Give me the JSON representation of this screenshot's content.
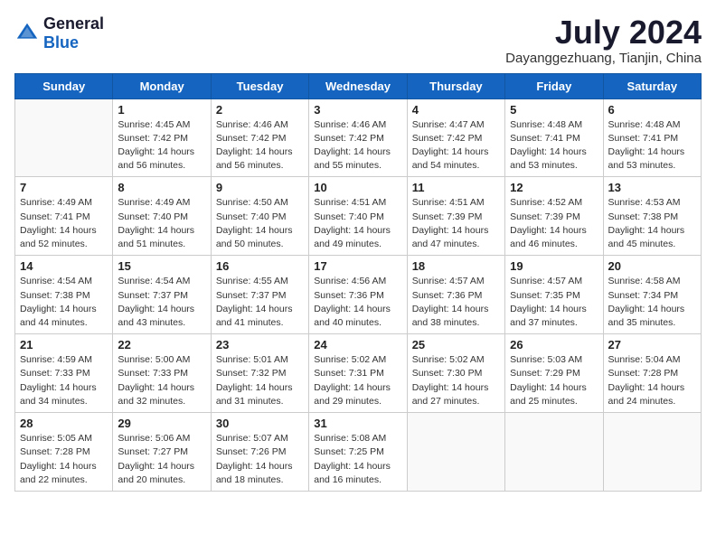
{
  "header": {
    "logo_general": "General",
    "logo_blue": "Blue",
    "month_year": "July 2024",
    "location": "Dayanggezhuang, Tianjin, China"
  },
  "weekdays": [
    "Sunday",
    "Monday",
    "Tuesday",
    "Wednesday",
    "Thursday",
    "Friday",
    "Saturday"
  ],
  "weeks": [
    [
      {
        "day": "",
        "info": ""
      },
      {
        "day": "1",
        "info": "Sunrise: 4:45 AM\nSunset: 7:42 PM\nDaylight: 14 hours\nand 56 minutes."
      },
      {
        "day": "2",
        "info": "Sunrise: 4:46 AM\nSunset: 7:42 PM\nDaylight: 14 hours\nand 56 minutes."
      },
      {
        "day": "3",
        "info": "Sunrise: 4:46 AM\nSunset: 7:42 PM\nDaylight: 14 hours\nand 55 minutes."
      },
      {
        "day": "4",
        "info": "Sunrise: 4:47 AM\nSunset: 7:42 PM\nDaylight: 14 hours\nand 54 minutes."
      },
      {
        "day": "5",
        "info": "Sunrise: 4:48 AM\nSunset: 7:41 PM\nDaylight: 14 hours\nand 53 minutes."
      },
      {
        "day": "6",
        "info": "Sunrise: 4:48 AM\nSunset: 7:41 PM\nDaylight: 14 hours\nand 53 minutes."
      }
    ],
    [
      {
        "day": "7",
        "info": "Sunrise: 4:49 AM\nSunset: 7:41 PM\nDaylight: 14 hours\nand 52 minutes."
      },
      {
        "day": "8",
        "info": "Sunrise: 4:49 AM\nSunset: 7:40 PM\nDaylight: 14 hours\nand 51 minutes."
      },
      {
        "day": "9",
        "info": "Sunrise: 4:50 AM\nSunset: 7:40 PM\nDaylight: 14 hours\nand 50 minutes."
      },
      {
        "day": "10",
        "info": "Sunrise: 4:51 AM\nSunset: 7:40 PM\nDaylight: 14 hours\nand 49 minutes."
      },
      {
        "day": "11",
        "info": "Sunrise: 4:51 AM\nSunset: 7:39 PM\nDaylight: 14 hours\nand 47 minutes."
      },
      {
        "day": "12",
        "info": "Sunrise: 4:52 AM\nSunset: 7:39 PM\nDaylight: 14 hours\nand 46 minutes."
      },
      {
        "day": "13",
        "info": "Sunrise: 4:53 AM\nSunset: 7:38 PM\nDaylight: 14 hours\nand 45 minutes."
      }
    ],
    [
      {
        "day": "14",
        "info": "Sunrise: 4:54 AM\nSunset: 7:38 PM\nDaylight: 14 hours\nand 44 minutes."
      },
      {
        "day": "15",
        "info": "Sunrise: 4:54 AM\nSunset: 7:37 PM\nDaylight: 14 hours\nand 43 minutes."
      },
      {
        "day": "16",
        "info": "Sunrise: 4:55 AM\nSunset: 7:37 PM\nDaylight: 14 hours\nand 41 minutes."
      },
      {
        "day": "17",
        "info": "Sunrise: 4:56 AM\nSunset: 7:36 PM\nDaylight: 14 hours\nand 40 minutes."
      },
      {
        "day": "18",
        "info": "Sunrise: 4:57 AM\nSunset: 7:36 PM\nDaylight: 14 hours\nand 38 minutes."
      },
      {
        "day": "19",
        "info": "Sunrise: 4:57 AM\nSunset: 7:35 PM\nDaylight: 14 hours\nand 37 minutes."
      },
      {
        "day": "20",
        "info": "Sunrise: 4:58 AM\nSunset: 7:34 PM\nDaylight: 14 hours\nand 35 minutes."
      }
    ],
    [
      {
        "day": "21",
        "info": "Sunrise: 4:59 AM\nSunset: 7:33 PM\nDaylight: 14 hours\nand 34 minutes."
      },
      {
        "day": "22",
        "info": "Sunrise: 5:00 AM\nSunset: 7:33 PM\nDaylight: 14 hours\nand 32 minutes."
      },
      {
        "day": "23",
        "info": "Sunrise: 5:01 AM\nSunset: 7:32 PM\nDaylight: 14 hours\nand 31 minutes."
      },
      {
        "day": "24",
        "info": "Sunrise: 5:02 AM\nSunset: 7:31 PM\nDaylight: 14 hours\nand 29 minutes."
      },
      {
        "day": "25",
        "info": "Sunrise: 5:02 AM\nSunset: 7:30 PM\nDaylight: 14 hours\nand 27 minutes."
      },
      {
        "day": "26",
        "info": "Sunrise: 5:03 AM\nSunset: 7:29 PM\nDaylight: 14 hours\nand 25 minutes."
      },
      {
        "day": "27",
        "info": "Sunrise: 5:04 AM\nSunset: 7:28 PM\nDaylight: 14 hours\nand 24 minutes."
      }
    ],
    [
      {
        "day": "28",
        "info": "Sunrise: 5:05 AM\nSunset: 7:28 PM\nDaylight: 14 hours\nand 22 minutes."
      },
      {
        "day": "29",
        "info": "Sunrise: 5:06 AM\nSunset: 7:27 PM\nDaylight: 14 hours\nand 20 minutes."
      },
      {
        "day": "30",
        "info": "Sunrise: 5:07 AM\nSunset: 7:26 PM\nDaylight: 14 hours\nand 18 minutes."
      },
      {
        "day": "31",
        "info": "Sunrise: 5:08 AM\nSunset: 7:25 PM\nDaylight: 14 hours\nand 16 minutes."
      },
      {
        "day": "",
        "info": ""
      },
      {
        "day": "",
        "info": ""
      },
      {
        "day": "",
        "info": ""
      }
    ]
  ]
}
